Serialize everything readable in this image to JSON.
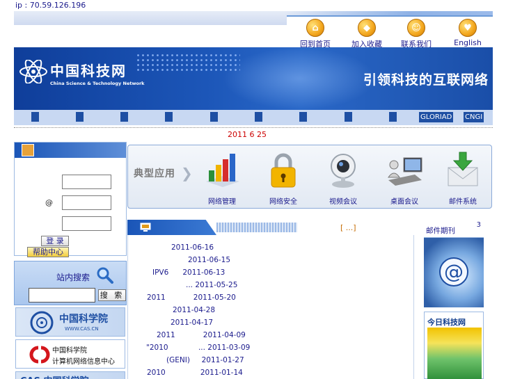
{
  "ip_bar": "ip  : 70.59.126.196",
  "nav": [
    {
      "label": "回到首页",
      "icon": "home-icon",
      "glyph": "⌂"
    },
    {
      "label": "加入收藏",
      "icon": "favorite-icon",
      "glyph": "◆"
    },
    {
      "label": "联系我们",
      "icon": "contact-icon",
      "glyph": "☺"
    },
    {
      "label": "English",
      "icon": "english-icon",
      "glyph": "♥"
    }
  ],
  "banner": {
    "logo_cn": "中国科技网",
    "logo_en": "China Science & Technology Network",
    "slogan": "引领科技的互联网络"
  },
  "menu_tags": [
    "GLORIAD",
    "CNGI"
  ],
  "date": "2011 6 25",
  "login": {
    "at_label": "@",
    "login_button": "登 录",
    "help_button": "帮助中心"
  },
  "search": {
    "title": "站内搜索",
    "button": "搜 索"
  },
  "links": [
    {
      "text": "中国科学院",
      "sub": "WWW.CAS.CN"
    },
    {
      "text": "中国科学院",
      "sub": "计算机网络信息中心"
    },
    {
      "text": "CAS 中国科学院",
      "sub": ""
    }
  ],
  "apps": {
    "title": "典型应用",
    "items": [
      {
        "label": "网络管理",
        "icon": "network-management-icon"
      },
      {
        "label": "网络安全",
        "icon": "network-security-icon"
      },
      {
        "label": "视频会议",
        "icon": "video-conference-icon"
      },
      {
        "label": "桌面会议",
        "icon": "desktop-conference-icon"
      },
      {
        "label": "邮件系统",
        "icon": "mail-system-icon"
      }
    ]
  },
  "news": {
    "more": "[    ...]",
    "items": [
      {
        "title": "",
        "date": "2011-06-16"
      },
      {
        "title": "",
        "date": "2011-06-15"
      },
      {
        "title": "IPV6",
        "date": "2011-06-13"
      },
      {
        "title": "...",
        "date": "2011-05-25"
      },
      {
        "title": "2011",
        "date": "2011-05-20"
      },
      {
        "title": "",
        "date": "2011-04-28"
      },
      {
        "title": "",
        "date": "2011-04-17"
      },
      {
        "title": "2011",
        "date": "2011-04-09"
      },
      {
        "title": "\"2010",
        "date": "... 2011-03-09"
      },
      {
        "title": "(GENI)",
        "date": "2011-01-27"
      },
      {
        "title": "2010",
        "date": "2011-01-14"
      }
    ]
  },
  "journal": {
    "title": "邮件期刊",
    "issue": "3"
  },
  "today": {
    "title": "今日科技网"
  }
}
